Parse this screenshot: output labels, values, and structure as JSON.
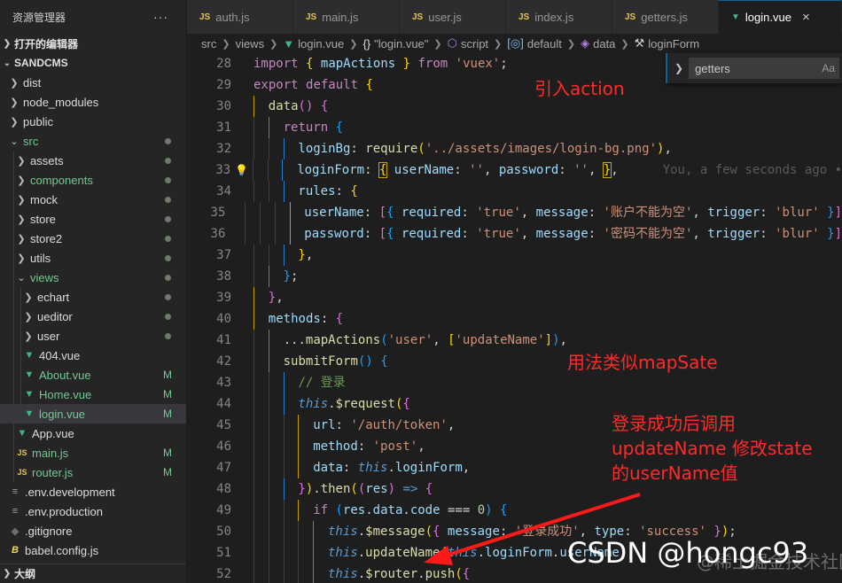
{
  "sidebar": {
    "title": "资源管理器",
    "more": "···",
    "open_editors": "打开的编辑器",
    "project": "SANDCMS",
    "outline": "大纲",
    "items": [
      {
        "name": "dist",
        "kind": "folder",
        "depth": 0,
        "expanded": false,
        "color": "white",
        "status": ""
      },
      {
        "name": "node_modules",
        "kind": "folder",
        "depth": 0,
        "expanded": false,
        "color": "white",
        "status": ""
      },
      {
        "name": "public",
        "kind": "folder",
        "depth": 0,
        "expanded": false,
        "color": "white",
        "status": ""
      },
      {
        "name": "src",
        "kind": "folder",
        "depth": 0,
        "expanded": true,
        "color": "green",
        "status": "dot"
      },
      {
        "name": "assets",
        "kind": "folder",
        "depth": 1,
        "expanded": false,
        "color": "white",
        "status": "dot"
      },
      {
        "name": "components",
        "kind": "folder",
        "depth": 1,
        "expanded": false,
        "color": "green",
        "status": "dot"
      },
      {
        "name": "mock",
        "kind": "folder",
        "depth": 1,
        "expanded": false,
        "color": "white",
        "status": "dot"
      },
      {
        "name": "store",
        "kind": "folder",
        "depth": 1,
        "expanded": false,
        "color": "white",
        "status": "dot"
      },
      {
        "name": "store2",
        "kind": "folder",
        "depth": 1,
        "expanded": false,
        "color": "white",
        "status": "dot"
      },
      {
        "name": "utils",
        "kind": "folder",
        "depth": 1,
        "expanded": false,
        "color": "white",
        "status": "dot"
      },
      {
        "name": "views",
        "kind": "folder",
        "depth": 1,
        "expanded": true,
        "color": "green",
        "status": "dot"
      },
      {
        "name": "echart",
        "kind": "folder",
        "depth": 2,
        "expanded": false,
        "color": "white",
        "status": "dot"
      },
      {
        "name": "ueditor",
        "kind": "folder",
        "depth": 2,
        "expanded": false,
        "color": "white",
        "status": "dot"
      },
      {
        "name": "user",
        "kind": "folder",
        "depth": 2,
        "expanded": false,
        "color": "white",
        "status": "dot"
      },
      {
        "name": "404.vue",
        "kind": "vue",
        "depth": 2,
        "color": "white",
        "status": ""
      },
      {
        "name": "About.vue",
        "kind": "vue",
        "depth": 2,
        "color": "green",
        "status": "M"
      },
      {
        "name": "Home.vue",
        "kind": "vue",
        "depth": 2,
        "color": "green",
        "status": "M"
      },
      {
        "name": "login.vue",
        "kind": "vue",
        "depth": 2,
        "color": "green",
        "status": "M",
        "selected": true
      },
      {
        "name": "App.vue",
        "kind": "vue",
        "depth": 1,
        "color": "white",
        "status": ""
      },
      {
        "name": "main.js",
        "kind": "js",
        "depth": 1,
        "color": "green",
        "status": "M"
      },
      {
        "name": "router.js",
        "kind": "js",
        "depth": 1,
        "color": "green",
        "status": "M"
      },
      {
        "name": ".env.development",
        "kind": "env",
        "depth": 0,
        "color": "white",
        "status": ""
      },
      {
        "name": ".env.production",
        "kind": "env",
        "depth": 0,
        "color": "white",
        "status": ""
      },
      {
        "name": ".gitignore",
        "kind": "git",
        "depth": 0,
        "color": "white",
        "status": ""
      },
      {
        "name": "babel.config.js",
        "kind": "babel",
        "depth": 0,
        "color": "white",
        "status": ""
      }
    ]
  },
  "tabs": [
    {
      "label": "auth.js",
      "icon": "JS",
      "active": false
    },
    {
      "label": "main.js",
      "icon": "JS",
      "active": false
    },
    {
      "label": "user.js",
      "icon": "JS",
      "active": false
    },
    {
      "label": "index.js",
      "icon": "JS",
      "active": false
    },
    {
      "label": "getters.js",
      "icon": "JS",
      "active": false
    },
    {
      "label": "login.vue",
      "icon": "V",
      "active": true,
      "close": "×"
    }
  ],
  "breadcrumbs": [
    {
      "label": "src",
      "icon": ""
    },
    {
      "label": "views",
      "icon": ""
    },
    {
      "label": "login.vue",
      "icon": "V"
    },
    {
      "label": "\"login.vue\"",
      "icon": "{}"
    },
    {
      "label": "script",
      "icon": "⬡"
    },
    {
      "label": "default",
      "icon": "[◎]"
    },
    {
      "label": "data",
      "icon": "◈"
    },
    {
      "label": "loginForm",
      "icon": "🔧"
    }
  ],
  "find_widget": {
    "value": "getters",
    "toggle": "Aa"
  },
  "editor": {
    "blame": "You, a few seconds ago •",
    "lines": [
      {
        "n": "28",
        "indent": 0,
        "tokens": [
          [
            "k-kw",
            "import"
          ],
          [
            "k-pun",
            " "
          ],
          [
            "k-b1",
            "{"
          ],
          [
            "k-pun",
            " "
          ],
          [
            "k-var",
            "mapActions"
          ],
          [
            "k-pun",
            " "
          ],
          [
            "k-b1",
            "}"
          ],
          [
            "k-pun",
            " "
          ],
          [
            "k-kw",
            "from"
          ],
          [
            "k-pun",
            " "
          ],
          [
            "k-str",
            "'vuex'"
          ],
          [
            "k-pun",
            ";"
          ]
        ]
      },
      {
        "n": "29",
        "indent": 0,
        "tokens": [
          [
            "k-kw",
            "export"
          ],
          [
            "k-pun",
            " "
          ],
          [
            "k-kw",
            "default"
          ],
          [
            "k-pun",
            " "
          ],
          [
            "k-b1",
            "{"
          ]
        ]
      },
      {
        "n": "30",
        "indent": 1,
        "tokens": [
          [
            "k-fn",
            "data"
          ],
          [
            "k-b2",
            "()"
          ],
          [
            "k-pun",
            " "
          ],
          [
            "k-b2",
            "{"
          ]
        ]
      },
      {
        "n": "31",
        "indent": 2,
        "tokens": [
          [
            "k-kw",
            "return"
          ],
          [
            "k-pun",
            " "
          ],
          [
            "k-b3",
            "{"
          ]
        ]
      },
      {
        "n": "32",
        "indent": 3,
        "tokens": [
          [
            "k-pr",
            "loginBg"
          ],
          [
            "k-pun",
            ": "
          ],
          [
            "k-fn",
            "require"
          ],
          [
            "k-b1",
            "("
          ],
          [
            "k-str",
            "'../assets/images/login-bg.png'"
          ],
          [
            "k-b1",
            ")"
          ],
          [
            "k-pun",
            ","
          ]
        ]
      },
      {
        "n": "33",
        "indent": 3,
        "bulb": true,
        "blame": true,
        "tokens": [
          [
            "k-pr",
            "loginForm"
          ],
          [
            "k-pun",
            ": "
          ],
          [
            "k-b1 sel-box",
            "{"
          ],
          [
            "k-pun",
            " "
          ],
          [
            "k-pr",
            "userName"
          ],
          [
            "k-pun",
            ": "
          ],
          [
            "k-str",
            "''"
          ],
          [
            "k-pun",
            ", "
          ],
          [
            "k-pr",
            "password"
          ],
          [
            "k-pun",
            ": "
          ],
          [
            "k-str",
            "''"
          ],
          [
            "k-pun",
            ", "
          ],
          [
            "k-b1 sel-box",
            "}"
          ],
          [
            "k-pun",
            ","
          ]
        ]
      },
      {
        "n": "34",
        "indent": 3,
        "tokens": [
          [
            "k-pr",
            "rules"
          ],
          [
            "k-pun",
            ": "
          ],
          [
            "k-b1",
            "{"
          ]
        ]
      },
      {
        "n": "35",
        "indent": 4,
        "tokens": [
          [
            "k-pr",
            "userName"
          ],
          [
            "k-pun",
            ": "
          ],
          [
            "k-b2",
            "["
          ],
          [
            "k-b3",
            "{"
          ],
          [
            "k-pun",
            " "
          ],
          [
            "k-pr",
            "required"
          ],
          [
            "k-pun",
            ": "
          ],
          [
            "k-str",
            "'true'"
          ],
          [
            "k-pun",
            ", "
          ],
          [
            "k-pr",
            "message"
          ],
          [
            "k-pun",
            ": "
          ],
          [
            "k-str",
            "'账户不能为空'"
          ],
          [
            "k-pun",
            ", "
          ],
          [
            "k-pr",
            "trigger"
          ],
          [
            "k-pun",
            ": "
          ],
          [
            "k-str",
            "'blur'"
          ],
          [
            "k-pun",
            " "
          ],
          [
            "k-b3",
            "}"
          ],
          [
            "k-b2",
            "]"
          ]
        ]
      },
      {
        "n": "36",
        "indent": 4,
        "tokens": [
          [
            "k-pr",
            "password"
          ],
          [
            "k-pun",
            ": "
          ],
          [
            "k-b2",
            "["
          ],
          [
            "k-b3",
            "{"
          ],
          [
            "k-pun",
            " "
          ],
          [
            "k-pr",
            "required"
          ],
          [
            "k-pun",
            ": "
          ],
          [
            "k-str",
            "'true'"
          ],
          [
            "k-pun",
            ", "
          ],
          [
            "k-pr",
            "message"
          ],
          [
            "k-pun",
            ": "
          ],
          [
            "k-str",
            "'密码不能为空'"
          ],
          [
            "k-pun",
            ", "
          ],
          [
            "k-pr",
            "trigger"
          ],
          [
            "k-pun",
            ": "
          ],
          [
            "k-str",
            "'blur'"
          ],
          [
            "k-pun",
            " "
          ],
          [
            "k-b3",
            "}"
          ],
          [
            "k-b2",
            "]"
          ]
        ]
      },
      {
        "n": "37",
        "indent": 3,
        "tokens": [
          [
            "k-b1",
            "}"
          ],
          [
            "k-pun",
            ","
          ]
        ]
      },
      {
        "n": "38",
        "indent": 2,
        "tokens": [
          [
            "k-b3",
            "}"
          ],
          [
            "k-pun",
            ";"
          ]
        ]
      },
      {
        "n": "39",
        "indent": 1,
        "tokens": [
          [
            "k-b2",
            "}"
          ],
          [
            "k-pun",
            ","
          ]
        ]
      },
      {
        "n": "40",
        "indent": 1,
        "tokens": [
          [
            "k-pr",
            "methods"
          ],
          [
            "k-pun",
            ": "
          ],
          [
            "k-b2",
            "{"
          ]
        ]
      },
      {
        "n": "41",
        "indent": 2,
        "tokens": [
          [
            "k-pun",
            "..."
          ],
          [
            "k-fn",
            "mapActions"
          ],
          [
            "k-b3",
            "("
          ],
          [
            "k-str",
            "'user'"
          ],
          [
            "k-pun",
            ", "
          ],
          [
            "k-b1",
            "["
          ],
          [
            "k-str",
            "'updateName'"
          ],
          [
            "k-b1",
            "]"
          ],
          [
            "k-b3",
            ")"
          ],
          [
            "k-pun",
            ","
          ]
        ]
      },
      {
        "n": "42",
        "indent": 2,
        "tokens": [
          [
            "k-fn",
            "submitForm"
          ],
          [
            "k-b3",
            "()"
          ],
          [
            "k-pun",
            " "
          ],
          [
            "k-b3",
            "{"
          ]
        ]
      },
      {
        "n": "43",
        "indent": 3,
        "tokens": [
          [
            "k-cm",
            "// 登录"
          ]
        ]
      },
      {
        "n": "44",
        "indent": 3,
        "tokens": [
          [
            "k-this",
            "this"
          ],
          [
            "k-pun",
            "."
          ],
          [
            "k-fn",
            "$request"
          ],
          [
            "k-b1",
            "("
          ],
          [
            "k-b2",
            "{"
          ]
        ]
      },
      {
        "n": "45",
        "indent": 4,
        "tokens": [
          [
            "k-pr",
            "url"
          ],
          [
            "k-pun",
            ": "
          ],
          [
            "k-str",
            "'/auth/token'"
          ],
          [
            "k-pun",
            ","
          ]
        ]
      },
      {
        "n": "46",
        "indent": 4,
        "tokens": [
          [
            "k-pr",
            "method"
          ],
          [
            "k-pun",
            ": "
          ],
          [
            "k-str",
            "'post'"
          ],
          [
            "k-pun",
            ","
          ]
        ]
      },
      {
        "n": "47",
        "indent": 4,
        "tokens": [
          [
            "k-pr",
            "data"
          ],
          [
            "k-pun",
            ": "
          ],
          [
            "k-this",
            "this"
          ],
          [
            "k-pun",
            "."
          ],
          [
            "k-pr",
            "loginForm"
          ],
          [
            "k-pun",
            ","
          ]
        ]
      },
      {
        "n": "48",
        "indent": 3,
        "tokens": [
          [
            "k-b2",
            "}"
          ],
          [
            "k-b1",
            ")"
          ],
          [
            "k-pun",
            "."
          ],
          [
            "k-fn",
            "then"
          ],
          [
            "k-b1",
            "("
          ],
          [
            "k-b2",
            "("
          ],
          [
            "k-var",
            "res"
          ],
          [
            "k-b2",
            ")"
          ],
          [
            "k-pun",
            " "
          ],
          [
            "k-st",
            "=>"
          ],
          [
            "k-pun",
            " "
          ],
          [
            "k-b2",
            "{"
          ]
        ]
      },
      {
        "n": "49",
        "indent": 4,
        "tokens": [
          [
            "k-kw",
            "if"
          ],
          [
            "k-pun",
            " "
          ],
          [
            "k-b3",
            "("
          ],
          [
            "k-var",
            "res"
          ],
          [
            "k-pun",
            "."
          ],
          [
            "k-pr",
            "data"
          ],
          [
            "k-pun",
            "."
          ],
          [
            "k-pr",
            "code"
          ],
          [
            "k-pun",
            " === "
          ],
          [
            "k-num",
            "0"
          ],
          [
            "k-b3",
            ")"
          ],
          [
            "k-pun",
            " "
          ],
          [
            "k-b3",
            "{"
          ]
        ]
      },
      {
        "n": "50",
        "indent": 5,
        "tokens": [
          [
            "k-this",
            "this"
          ],
          [
            "k-pun",
            "."
          ],
          [
            "k-fn",
            "$message"
          ],
          [
            "k-b1",
            "("
          ],
          [
            "k-b2",
            "{"
          ],
          [
            "k-pun",
            " "
          ],
          [
            "k-pr",
            "message"
          ],
          [
            "k-pun",
            ": "
          ],
          [
            "k-str",
            "'登录成功'"
          ],
          [
            "k-pun",
            ", "
          ],
          [
            "k-pr",
            "type"
          ],
          [
            "k-pun",
            ": "
          ],
          [
            "k-str",
            "'success'"
          ],
          [
            "k-pun",
            " "
          ],
          [
            "k-b2",
            "}"
          ],
          [
            "k-b1",
            ")"
          ],
          [
            "k-pun",
            ";"
          ]
        ]
      },
      {
        "n": "51",
        "indent": 5,
        "tokens": [
          [
            "k-this",
            "this"
          ],
          [
            "k-pun",
            "."
          ],
          [
            "k-fn",
            "updateName"
          ],
          [
            "k-b1",
            "("
          ],
          [
            "k-this",
            "this"
          ],
          [
            "k-pun",
            "."
          ],
          [
            "k-pr",
            "loginForm"
          ],
          [
            "k-pun",
            "."
          ],
          [
            "k-pr",
            "userName"
          ],
          [
            "k-b1",
            ")"
          ],
          [
            "k-pun",
            ";"
          ]
        ]
      },
      {
        "n": "52",
        "indent": 5,
        "tokens": [
          [
            "k-this",
            "this"
          ],
          [
            "k-pun",
            "."
          ],
          [
            "k-fn",
            "$router"
          ],
          [
            "k-pun",
            "."
          ],
          [
            "k-fn",
            "push"
          ],
          [
            "k-b1",
            "("
          ],
          [
            "k-b2",
            "{"
          ]
        ]
      }
    ]
  },
  "annotations": {
    "a1": "引入action",
    "a2": "用法类似mapSate",
    "a3_l1": "登录成功后调用",
    "a3_l2": "updateName  修改state",
    "a3_l3": "的userName值"
  },
  "watermark": "CSDN @hongc93",
  "watermark2": "@稀土掘金技术社区",
  "colors": {
    "accent": "#0e639c",
    "annotation": "#ff2a2a",
    "modified": "#73c991"
  }
}
